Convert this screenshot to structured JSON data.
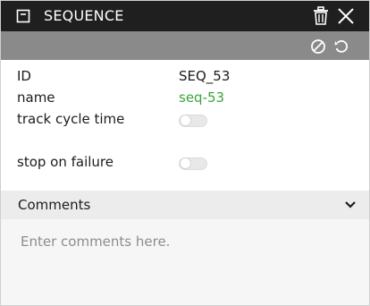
{
  "panel": {
    "title": "SEQUENCE",
    "icons": {
      "title": "panel-icon",
      "delete": "trash-icon",
      "close": "close-icon",
      "disable": "disable-icon",
      "reset": "undo-icon",
      "comments_toggle": "chevron-down-icon"
    }
  },
  "properties": {
    "id": {
      "label": "ID",
      "value": "SEQ_53"
    },
    "name": {
      "label": "name",
      "value": "seq-53"
    },
    "track_cycle_time": {
      "label": "track cycle time",
      "checked": false
    },
    "stop_on_failure": {
      "label": "stop on failure",
      "checked": false
    }
  },
  "comments": {
    "header": "Comments",
    "placeholder": "Enter comments here.",
    "value": ""
  },
  "colors": {
    "titlebar": "#1f1f1f",
    "toolbar": "#8a8a8a",
    "name_link": "#3aa53a",
    "comments_header": "#ececec",
    "comments_area": "#f6f6f6"
  }
}
